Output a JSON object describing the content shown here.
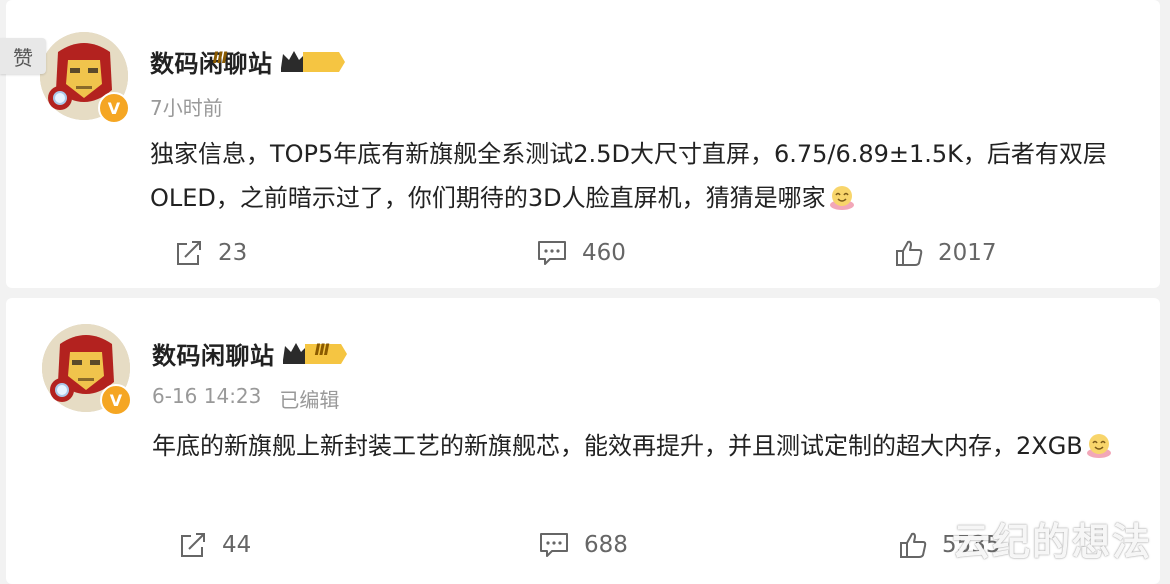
{
  "posts": [
    {
      "like_tag": "赞",
      "author": "数码闲聊站",
      "level_badge": "Ⅲ",
      "verified_badge": "V",
      "time": "7小时前",
      "edited": "",
      "content": "独家信息，TOP5年底有新旗舰全系测试2.5D大尺寸直屏，6.75/6.89±1.5K，后者有双层OLED，之前暗示过了，你们期待的3D人脸直屏机，猜猜是哪家",
      "emoji": "grinning-face-emoji",
      "shares": "23",
      "comments": "460",
      "likes": "2017"
    },
    {
      "like_tag": "",
      "author": "数码闲聊站",
      "level_badge": "Ⅲ",
      "verified_badge": "V",
      "time": "6-16 14:23",
      "edited": "已编辑",
      "content": "年底的新旗舰上新封装工艺的新旗舰芯，能效再提升，并且测试定制的超大内存，2XGB",
      "emoji": "grinning-face-emoji",
      "shares": "44",
      "comments": "688",
      "likes": "5535"
    }
  ],
  "watermark": "云纪的想法",
  "icons": {
    "share": "share-icon",
    "comment": "comment-icon",
    "like": "thumbs-up-icon",
    "crown": "crown-icon",
    "avatar": "iron-man-avatar"
  },
  "colors": {
    "background": "#f2f2f2",
    "card": "#ffffff",
    "text": "#222222",
    "meta": "#999999",
    "badge": "#f5a623"
  }
}
